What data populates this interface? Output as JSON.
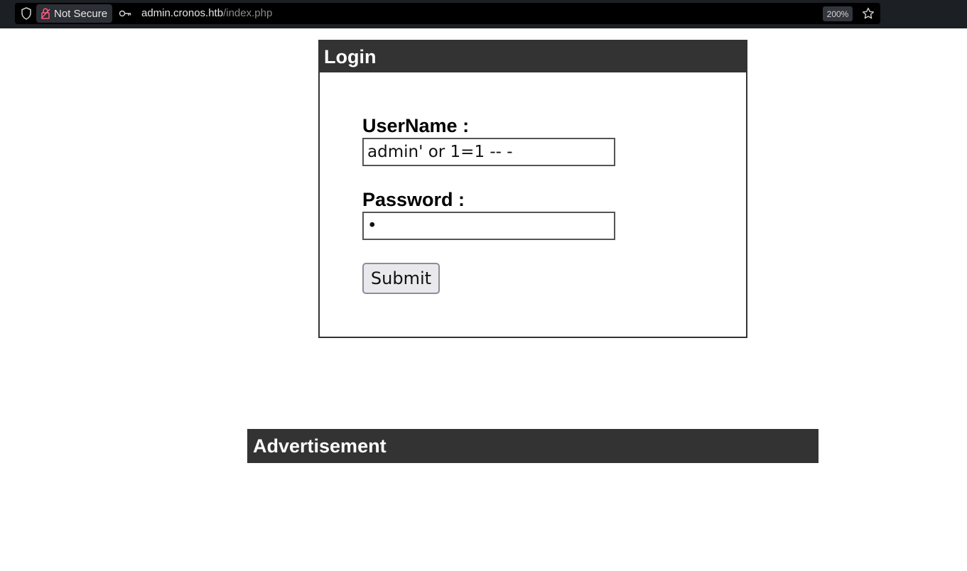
{
  "browser": {
    "security_label": "Not Secure",
    "url_host": "admin.cronos.htb",
    "url_path": "/index.php",
    "zoom": "200%",
    "icons": [
      "shield-icon",
      "lock-warning-icon",
      "key-icon",
      "star-icon"
    ]
  },
  "login": {
    "title": "Login",
    "username_label": "UserName :",
    "username_value": "admin' or 1=1 -- -",
    "password_label": "Password :",
    "password_masked": "•",
    "submit_label": "Submit"
  },
  "advertisement": {
    "title": "Advertisement"
  },
  "colors": {
    "panel_header": "#333333",
    "browser_chrome": "#1c1f24",
    "url_field": "#000000",
    "button_bg": "#e9e9ed"
  }
}
